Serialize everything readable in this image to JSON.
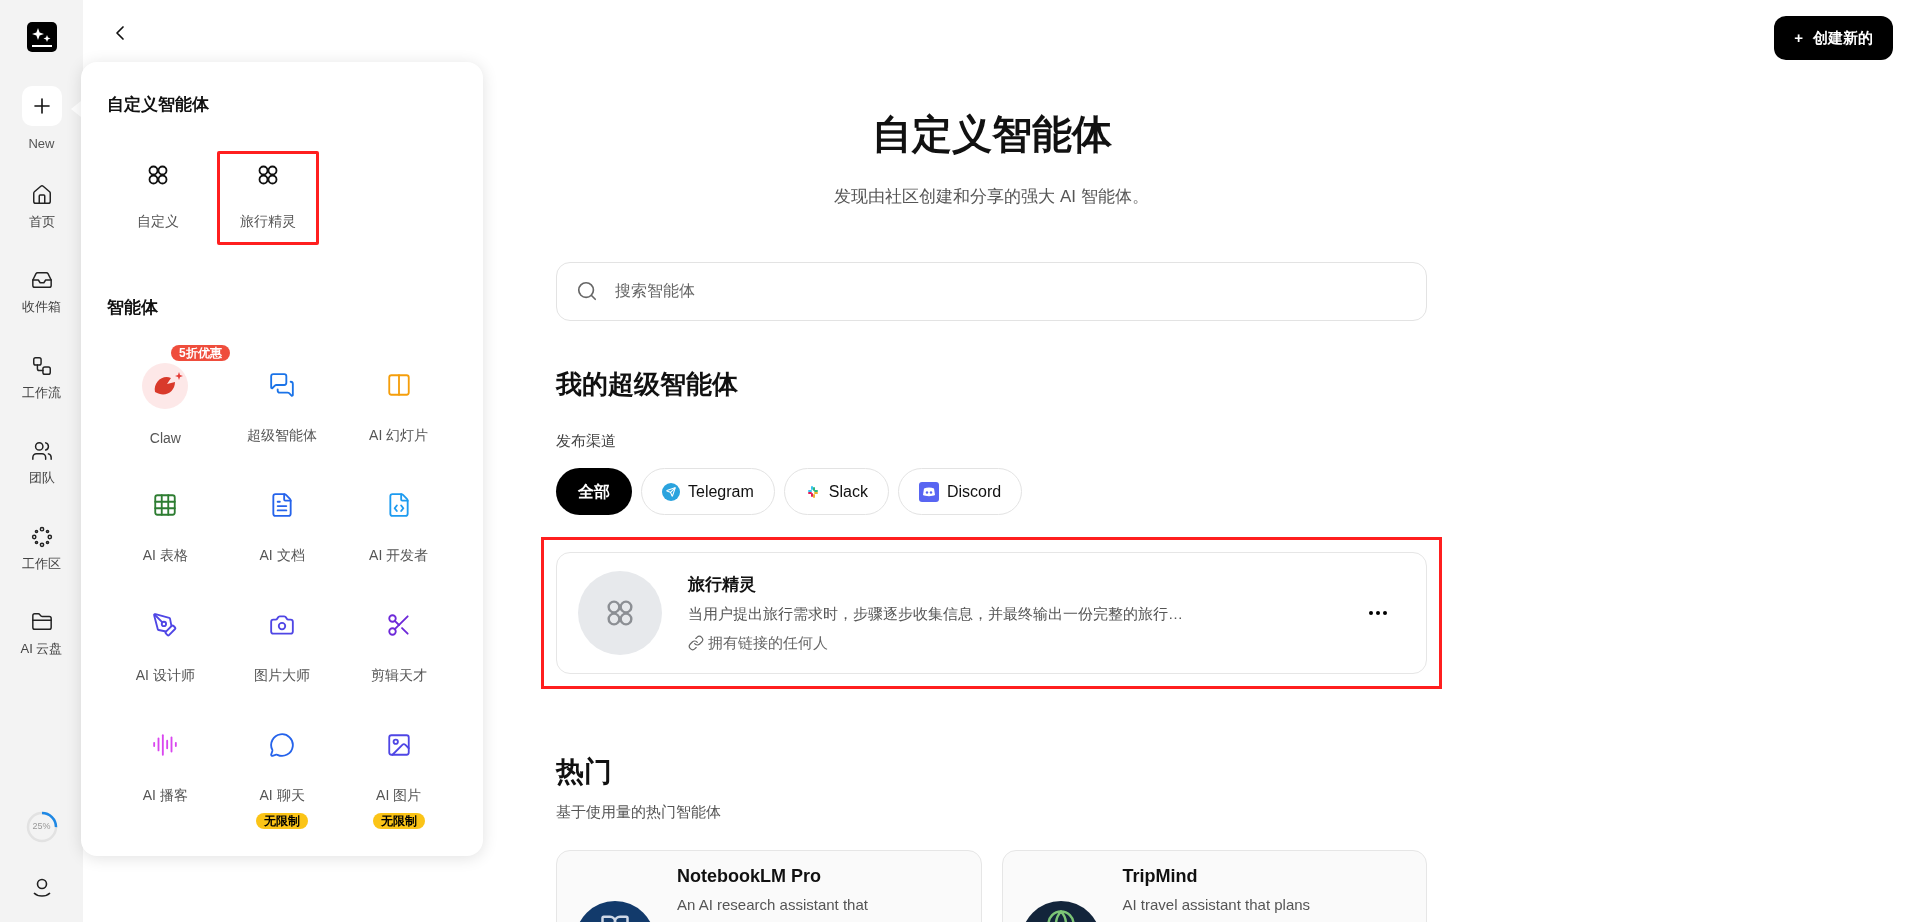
{
  "sidebar": {
    "new_button": {
      "label": "New"
    },
    "items": [
      {
        "label": "首页",
        "kind": "home"
      },
      {
        "label": "收件箱",
        "kind": "inbox"
      },
      {
        "label": "工作流",
        "kind": "workflow"
      },
      {
        "label": "团队",
        "kind": "team"
      },
      {
        "label": "工作区",
        "kind": "workspace"
      },
      {
        "label": "AI 云盘",
        "kind": "drive"
      }
    ],
    "usage": {
      "label": "25%",
      "level": 0.25
    }
  },
  "topbar": {
    "create_button": {
      "icon": "+",
      "label": "创建新的"
    }
  },
  "popup": {
    "custom_title": "自定义智能体",
    "custom_items": [
      {
        "label": "自定义",
        "highlighted": false
      },
      {
        "label": "旅行精灵",
        "highlighted": true
      }
    ],
    "agents_title": "智能体",
    "agents": [
      {
        "label": "Claw",
        "kind": "claw",
        "badge": {
          "text": "5折优惠",
          "kind": "promo"
        }
      },
      {
        "label": "超级智能体",
        "kind": "super"
      },
      {
        "label": "AI 幻灯片",
        "kind": "slides"
      },
      {
        "label": "AI 表格",
        "kind": "sheet"
      },
      {
        "label": "AI 文档",
        "kind": "doc"
      },
      {
        "label": "AI 开发者",
        "kind": "code"
      },
      {
        "label": "AI 设计师",
        "kind": "design"
      },
      {
        "label": "图片大师",
        "kind": "photo"
      },
      {
        "label": "剪辑天才",
        "kind": "video"
      },
      {
        "label": "AI 播客",
        "kind": "podcast"
      },
      {
        "label": "AI 聊天",
        "kind": "chat",
        "badge": {
          "text": "无限制",
          "kind": "unlimited"
        }
      },
      {
        "label": "AI 图片",
        "kind": "image",
        "badge": {
          "text": "无限制",
          "kind": "unlimited"
        }
      }
    ]
  },
  "main": {
    "title": "自定义智能体",
    "subtitle": "发现由社区创建和分享的强大 AI 智能体。",
    "search": {
      "placeholder": "搜索智能体"
    },
    "my_agents": {
      "heading": "我的超级智能体",
      "channel_label": "发布渠道",
      "channels": [
        {
          "label": "全部",
          "kind": "all",
          "selected": true
        },
        {
          "label": "Telegram",
          "kind": "telegram",
          "selected": false
        },
        {
          "label": "Slack",
          "kind": "slack",
          "selected": false
        },
        {
          "label": "Discord",
          "kind": "discord",
          "selected": false
        }
      ],
      "cards": [
        {
          "name": "旅行精灵",
          "description": "当用户提出旅行需求时，步骤逐步收集信息，并最终输出一份完整的旅行…",
          "access": "拥有链接的任何人",
          "highlighted": true
        }
      ]
    },
    "popular": {
      "heading": "热门",
      "subtitle": "基于使用量的热门智能体",
      "cards": [
        {
          "name": "NotebookLM Pro",
          "description": "An AI research assistant that",
          "kind": "notebook"
        },
        {
          "name": "TripMind",
          "description": "AI travel assistant that plans",
          "kind": "globe"
        }
      ]
    }
  }
}
